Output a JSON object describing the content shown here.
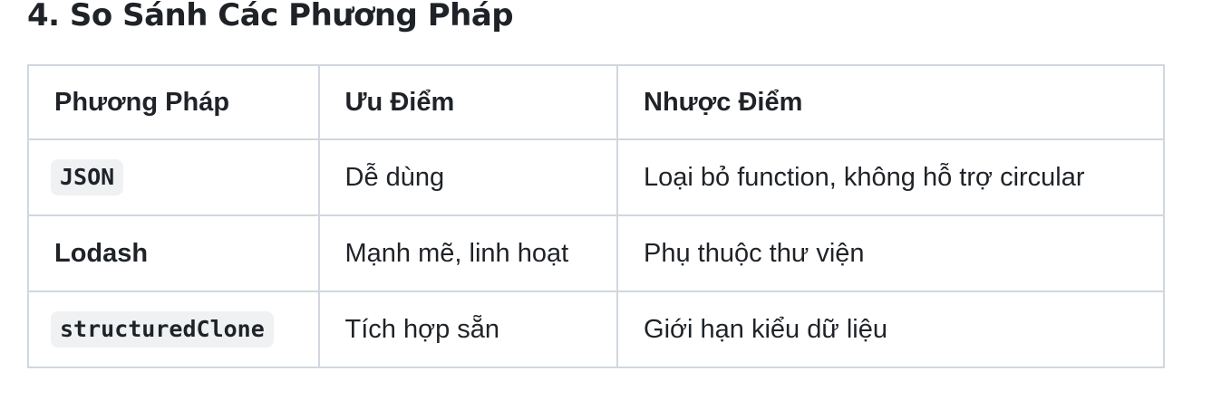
{
  "heading": "4. So Sánh Các Phương Pháp",
  "table": {
    "headers": [
      "Phương Pháp",
      "Ưu Điểm",
      "Nhược Điểm"
    ],
    "rows": [
      {
        "method": "JSON",
        "method_style": "code",
        "pros": "Dễ dùng",
        "cons": "Loại bỏ function, không hỗ trợ circular"
      },
      {
        "method": "Lodash",
        "method_style": "bold",
        "pros": "Mạnh mẽ, linh hoạt",
        "cons": "Phụ thuộc thư viện"
      },
      {
        "method": "structuredClone",
        "method_style": "code",
        "pros": "Tích hợp sẵn",
        "cons": "Giới hạn kiểu dữ liệu"
      }
    ]
  }
}
